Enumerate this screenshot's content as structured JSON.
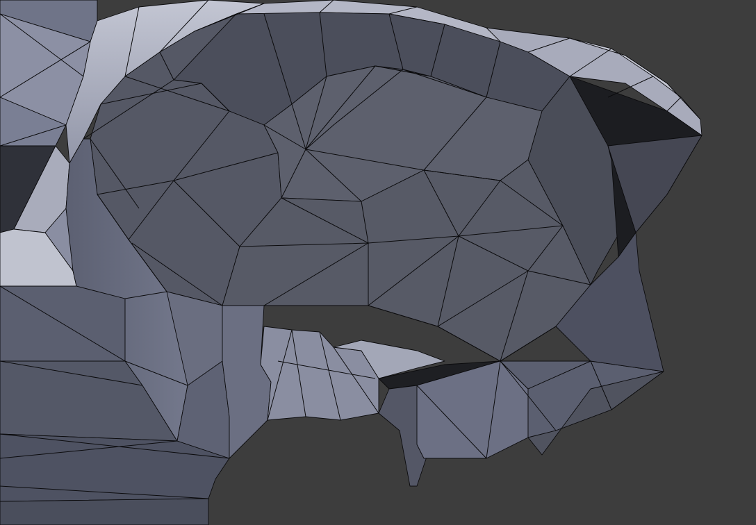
{
  "viewport": {
    "mode": "edit-mode-wireframe-overlay",
    "background_color": "#3d3d3d",
    "mesh_color_light": "#b9bccb",
    "mesh_color_mid": "#7d8297",
    "mesh_color_dark": "#4b4f5e",
    "mesh_color_shadow": "#1b1b1e",
    "edge_color": "#0b0b0d"
  }
}
